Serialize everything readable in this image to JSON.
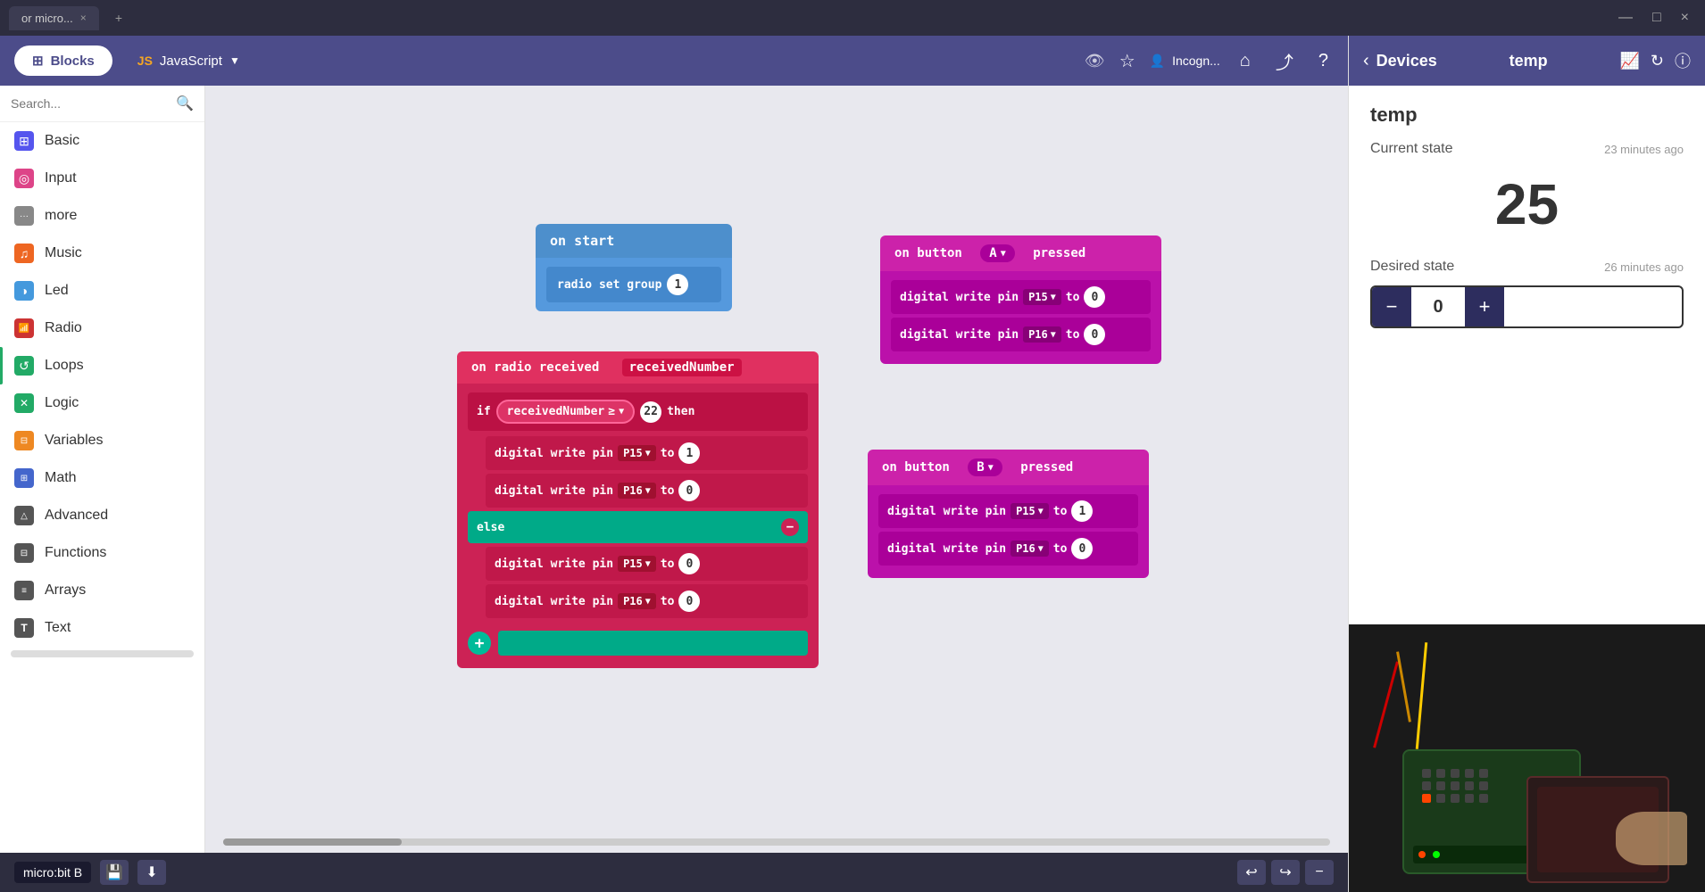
{
  "browser": {
    "tab_label": "or micro...",
    "tab_close": "×",
    "new_tab": "+",
    "minimize": "—",
    "maximize": "□",
    "close": "×"
  },
  "topbar": {
    "blocks_label": "Blocks",
    "js_label": "JavaScript",
    "home_icon": "⌂",
    "share_icon": "⤴",
    "help_icon": "?",
    "incognito_label": "Incogn...",
    "eye_icon": "👁",
    "star_icon": "☆"
  },
  "sidebar": {
    "search_placeholder": "Search...",
    "items": [
      {
        "label": "Basic",
        "color": "#5555ee",
        "icon": "⊞"
      },
      {
        "label": "Input",
        "color": "#dd4488",
        "icon": "◎"
      },
      {
        "label": "more",
        "color": "#888888",
        "icon": "···"
      },
      {
        "label": "Music",
        "color": "#ee6622",
        "icon": "♫"
      },
      {
        "label": "Led",
        "color": "#4499dd",
        "icon": "◑"
      },
      {
        "label": "Radio",
        "color": "#cc3333",
        "icon": "📶"
      },
      {
        "label": "Loops",
        "color": "#22aa66",
        "icon": "↺"
      },
      {
        "label": "Logic",
        "color": "#22aa66",
        "icon": "✕"
      },
      {
        "label": "Variables",
        "color": "#ee8822",
        "icon": "⊟"
      },
      {
        "label": "Math",
        "color": "#4466cc",
        "icon": "⊞"
      },
      {
        "label": "Advanced",
        "color": "#555555",
        "icon": "△"
      },
      {
        "label": "Functions",
        "color": "#555555",
        "icon": "⊟"
      },
      {
        "label": "Arrays",
        "color": "#555555",
        "icon": "≡"
      },
      {
        "label": "Text",
        "color": "#555555",
        "icon": "T"
      }
    ]
  },
  "workspace": {
    "block_on_start": {
      "header": "on start",
      "inner": "radio set group",
      "value": "1"
    },
    "block_radio_received": {
      "header": "on radio received",
      "param": "receivedNumber",
      "condition_var": "receivedNumber",
      "condition_op": "≥",
      "condition_val": "22",
      "then_label": "then",
      "pin1_a": "P15",
      "val1_a": "1",
      "pin2_a": "P16",
      "val2_a": "0",
      "else_label": "else",
      "pin1_b": "P15",
      "val1_b": "0",
      "pin2_b": "P16",
      "val2_b": "0",
      "to_label": "to"
    },
    "block_button_a": {
      "header_prefix": "on button",
      "button_name": "A",
      "header_suffix": "pressed",
      "pin1": "P15",
      "val1": "0",
      "pin2": "P16",
      "val2": "0",
      "to_label": "to"
    },
    "block_button_b": {
      "header_prefix": "on button",
      "button_name": "B",
      "header_suffix": "pressed",
      "pin1": "P15",
      "val1": "1",
      "pin2": "P16",
      "val2": "0",
      "to_label": "to"
    }
  },
  "bottom": {
    "device_name": "micro:bit B",
    "save_icon": "💾",
    "download_icon": "⬇",
    "undo_icon": "↩",
    "redo_icon": "↪",
    "minus_icon": "−"
  },
  "right_panel": {
    "back_icon": "‹",
    "title_devices": "Devices",
    "title_temp": "temp",
    "chart_icon": "📈",
    "refresh_icon": "↻",
    "info_icon": "ⓘ",
    "device_name": "temp",
    "current_state_label": "Current state",
    "current_state_time": "23 minutes ago",
    "current_state_value": "25",
    "desired_state_label": "Desired state",
    "desired_state_time": "26 minutes ago",
    "stepper_minus": "−",
    "stepper_value": "0",
    "stepper_plus": "+"
  }
}
